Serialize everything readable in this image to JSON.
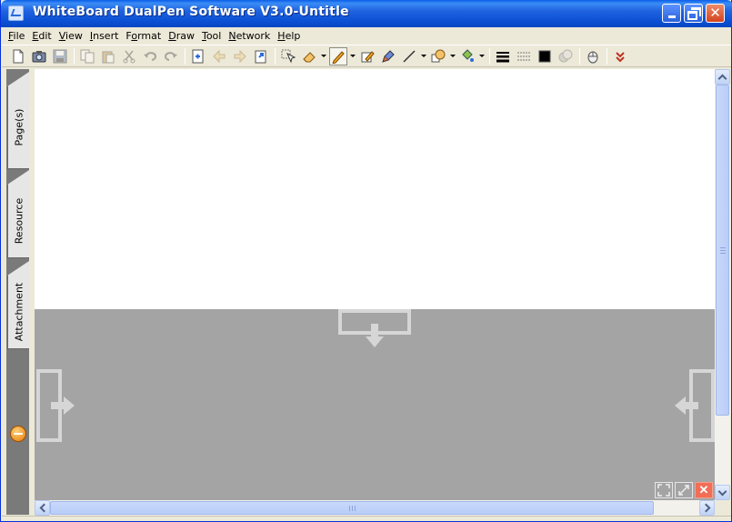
{
  "window": {
    "title": "WhiteBoard DualPen Software V3.0-Untitle",
    "controls": {
      "minimize": "minimize",
      "restore": "restore",
      "close": "close"
    }
  },
  "menu": [
    {
      "label": "File",
      "mnemonic": "F",
      "rest": "ile"
    },
    {
      "label": "Edit",
      "mnemonic": "E",
      "rest": "dit"
    },
    {
      "label": "View",
      "mnemonic": "V",
      "rest": "iew"
    },
    {
      "label": "Insert",
      "mnemonic": "I",
      "rest": "nsert"
    },
    {
      "label": "Format",
      "pre": "F",
      "mnemonic": "o",
      "rest": "rmat"
    },
    {
      "label": "Draw",
      "mnemonic": "D",
      "rest": "raw"
    },
    {
      "label": "Tool",
      "mnemonic": "T",
      "rest": "ool"
    },
    {
      "label": "Network",
      "mnemonic": "N",
      "rest": "etwork"
    },
    {
      "label": "Help",
      "mnemonic": "H",
      "rest": "elp"
    }
  ],
  "toolbar": {
    "items": [
      "new-page-icon",
      "screenshot-icon",
      "save-icon",
      "|",
      "copy-icon",
      "paste-icon",
      "cut-icon",
      "undo-icon",
      "redo-icon",
      "|",
      "insert-page-icon",
      "previous-page-icon",
      "next-page-icon",
      "export-icon",
      "|",
      "select-icon",
      "eraser-icon",
      "pen-icon",
      "highlighter-icon",
      "brush-icon",
      "line-icon",
      "shape-icon",
      "fill-icon",
      "|",
      "line-width-icon",
      "line-style-icon",
      "color-icon",
      "transparency-icon",
      "|",
      "mouse-icon",
      "|",
      "collapse-icon"
    ]
  },
  "side_tabs": [
    {
      "label": "Page(s)"
    },
    {
      "label": "Resource"
    },
    {
      "label": "Attachment"
    }
  ],
  "colors": {
    "accent": "#0a4fd2",
    "canvas_page": "#ffffff",
    "canvas_background": "#a4a4a4",
    "dock_guides": "#d6d6d6",
    "close_red": "#f26d56"
  }
}
